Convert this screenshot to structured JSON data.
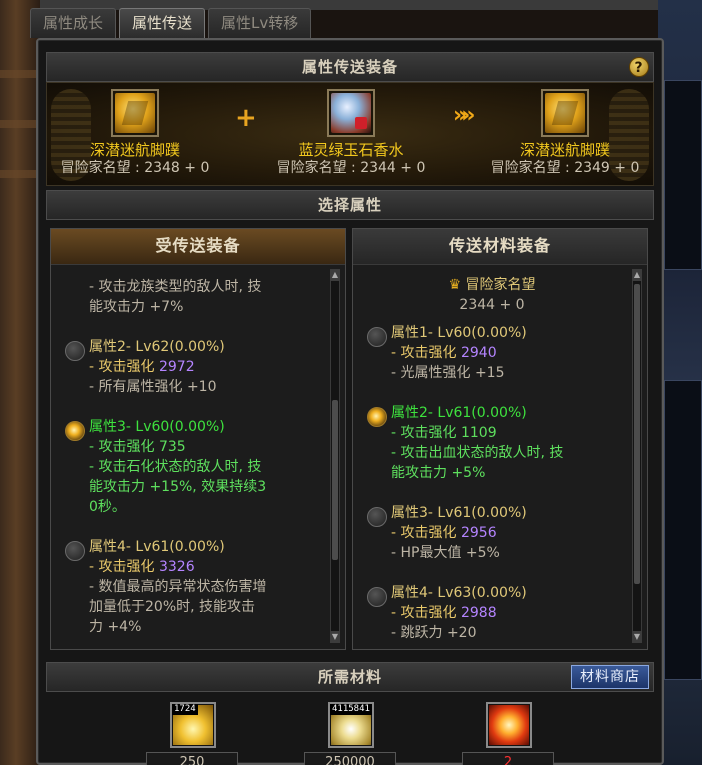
{
  "tabs": [
    {
      "label": "属性成长"
    },
    {
      "label": "属性传送"
    },
    {
      "label": "属性Lv转移"
    }
  ],
  "equip_section": {
    "title": "属性传送装备",
    "help_icon": "?"
  },
  "equipment": {
    "source": {
      "name": "深潜迷航脚蹼",
      "reputation": "冒险家名望 : 2348 + 0",
      "icon": "golden-tunic-icon"
    },
    "material": {
      "name": "蓝灵绿玉石香水",
      "reputation": "冒险家名望 : 2344 + 0",
      "icon": "perfume-potion-icon"
    },
    "result": {
      "name": "深潜迷航脚蹼",
      "reputation": "冒险家名望 : 2349 + 0",
      "icon": "golden-tunic-icon"
    },
    "plus": "+",
    "arrows": "»»"
  },
  "select_section": {
    "title": "选择属性"
  },
  "left_column": {
    "title": "受传送装备",
    "top_fragment": {
      "line1": "- 攻击龙族类型的敌人时, 技",
      "line2": "能攻击力 +7%"
    },
    "attr2": {
      "title": "属性2- Lv62(0.00%)",
      "line1_label": "- 攻击强化",
      "line1_value": "2972",
      "line2": "- 所有属性强化 +10"
    },
    "attr3": {
      "title": "属性3- Lv60(0.00%)",
      "line1_label": "- 攻击强化",
      "line1_value": "735",
      "line2": "- 攻击石化状态的敌人时, 技",
      "line3": "能攻击力 +15%, 效果持续3",
      "line4": "0秒。"
    },
    "attr4": {
      "title": "属性4- Lv61(0.00%)",
      "line1_label": "- 攻击强化",
      "line1_value": "3326",
      "line2": "- 数值最高的异常状态伤害增",
      "line3": "加量低于20%时, 技能攻击",
      "line4": "力 +4%"
    }
  },
  "right_column": {
    "title": "传送材料装备",
    "rep_label": "冒险家名望",
    "rep_value": "2344 + 0",
    "attr1": {
      "title": "属性1- Lv60(0.00%)",
      "line1_label": "- 攻击强化",
      "line1_value": "2940",
      "line2": "- 光属性强化 +15"
    },
    "attr2": {
      "title": "属性2- Lv61(0.00%)",
      "line1_label": "- 攻击强化",
      "line1_value": "1109",
      "line2": "- 攻击出血状态的敌人时, 技",
      "line3": "能攻击力 +5%"
    },
    "attr3": {
      "title": "属性3- Lv61(0.00%)",
      "line1_label": "- 攻击强化",
      "line1_value": "2956",
      "line2": "- HP最大值 +5%"
    },
    "attr4": {
      "title": "属性4- Lv63(0.00%)",
      "line1_label": "- 攻击强化",
      "line1_value": "2988",
      "line2": "- 跳跃力 +20"
    }
  },
  "materials_section": {
    "title": "所需材料",
    "shop_button": "材料商店"
  },
  "materials": [
    {
      "tag": "1724",
      "count": "250",
      "icon": "gem-icon"
    },
    {
      "tag": "4115841",
      "count": "250000",
      "icon": "coins-icon"
    },
    {
      "tag": "",
      "count": "2",
      "icon": "starburst-icon"
    }
  ],
  "colors": {
    "gold": "#f2c81e",
    "green": "#3ee23e",
    "purple": "#b484ff",
    "red": "#ff3030"
  }
}
